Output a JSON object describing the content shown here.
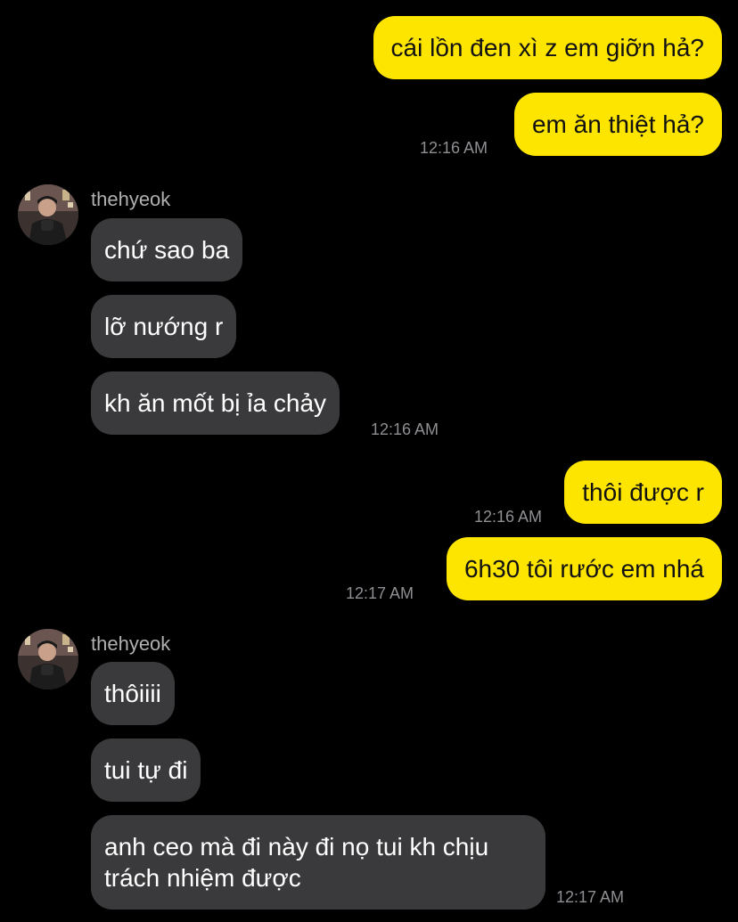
{
  "messages": [
    {
      "text": "cái lồn đen xì z em giỡn hả?"
    },
    {
      "text": "em ăn thiệt hả?"
    },
    {
      "time": "12:16 AM"
    },
    {
      "sender": "thehyeok"
    },
    {
      "text": "chứ sao ba"
    },
    {
      "text": "lỡ nướng r"
    },
    {
      "text": "kh ăn mốt bị ỉa chảy"
    },
    {
      "time": "12:16 AM"
    },
    {
      "text": "thôi được r"
    },
    {
      "time": "12:16 AM"
    },
    {
      "text": "6h30 tôi rước em nhá"
    },
    {
      "time": "12:17 AM"
    },
    {
      "sender": "thehyeok"
    },
    {
      "text": "thôiiii"
    },
    {
      "text": "tui tự đi"
    },
    {
      "text": "anh ceo mà đi này đi nọ tui kh chịu trách nhiệm được"
    },
    {
      "time": "12:17 AM"
    }
  ],
  "colors": {
    "background": "#000000",
    "outgoing_bubble": "#FEE500",
    "incoming_bubble": "#3A3A3C",
    "timestamp": "#8E8E93"
  }
}
